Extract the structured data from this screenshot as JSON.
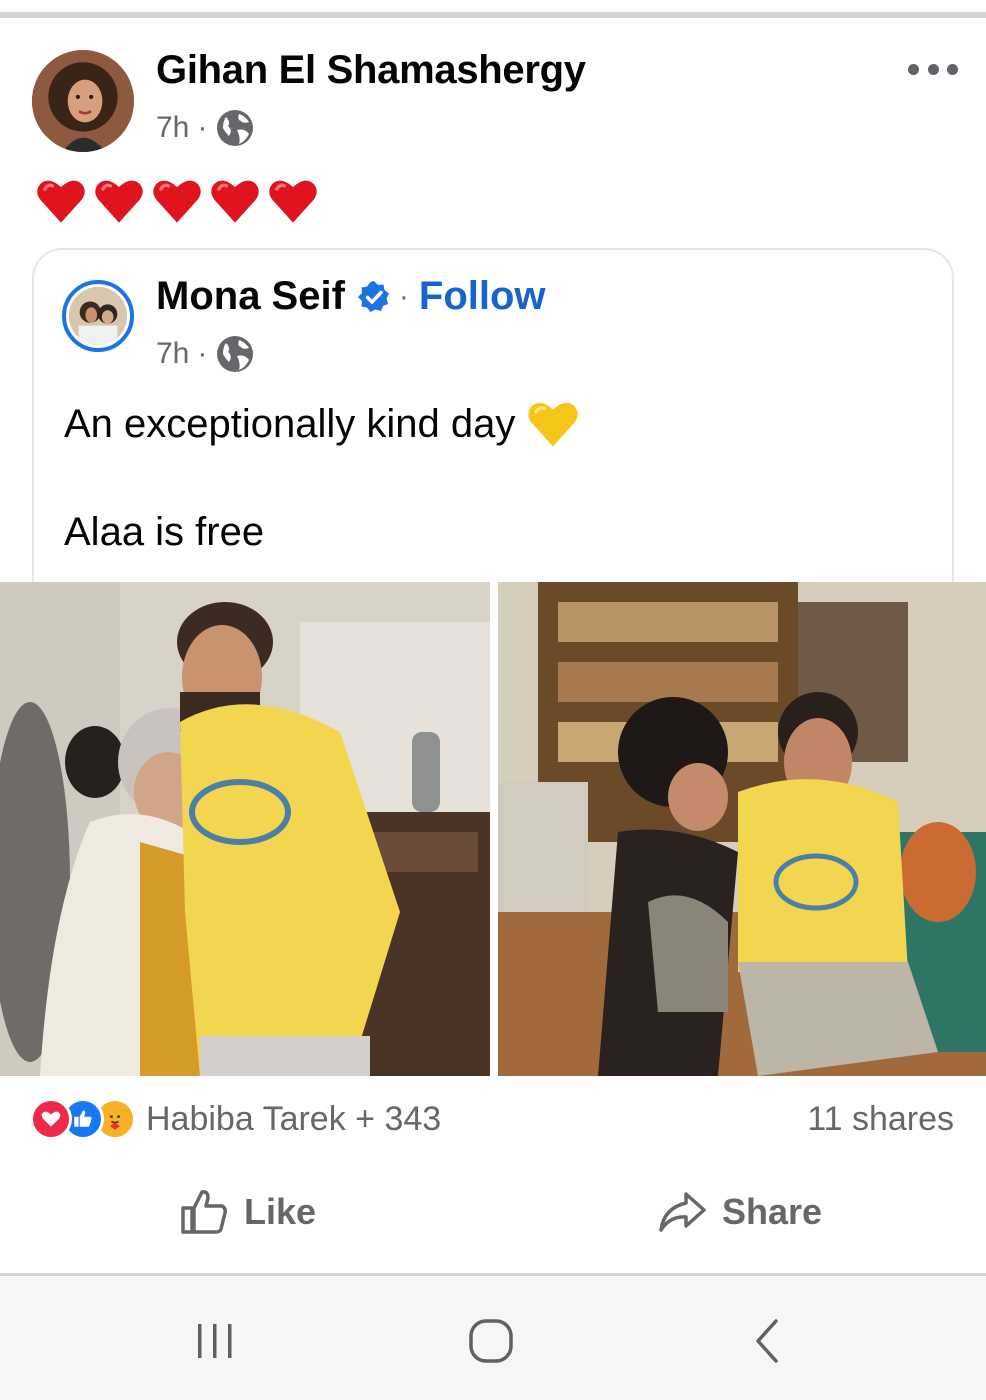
{
  "post": {
    "author": "Gihan El Shamashergy",
    "time": "7h",
    "separator": "·",
    "privacy_icon": "globe-icon",
    "content_emoji": [
      "red-heart",
      "red-heart",
      "red-heart",
      "red-heart",
      "red-heart"
    ]
  },
  "shared_post": {
    "author": "Mona Seif",
    "verified": true,
    "follow_separator": "·",
    "follow_label": "Follow",
    "time": "7h",
    "separator": "·",
    "text_line1": "An exceptionally kind day",
    "text_line2": "Alaa is free",
    "text_emoji": "yellow-heart"
  },
  "engagement": {
    "reaction_icons": [
      "love",
      "like",
      "care"
    ],
    "reactors": "Habiba Tarek + 343",
    "shares": "11 shares"
  },
  "actions": {
    "like_label": "Like",
    "share_label": "Share"
  },
  "colors": {
    "accent_blue": "#1763cf",
    "meta_gray": "#65676b",
    "heart_red": "#e0141e",
    "yellow_heart": "#f5c518"
  }
}
